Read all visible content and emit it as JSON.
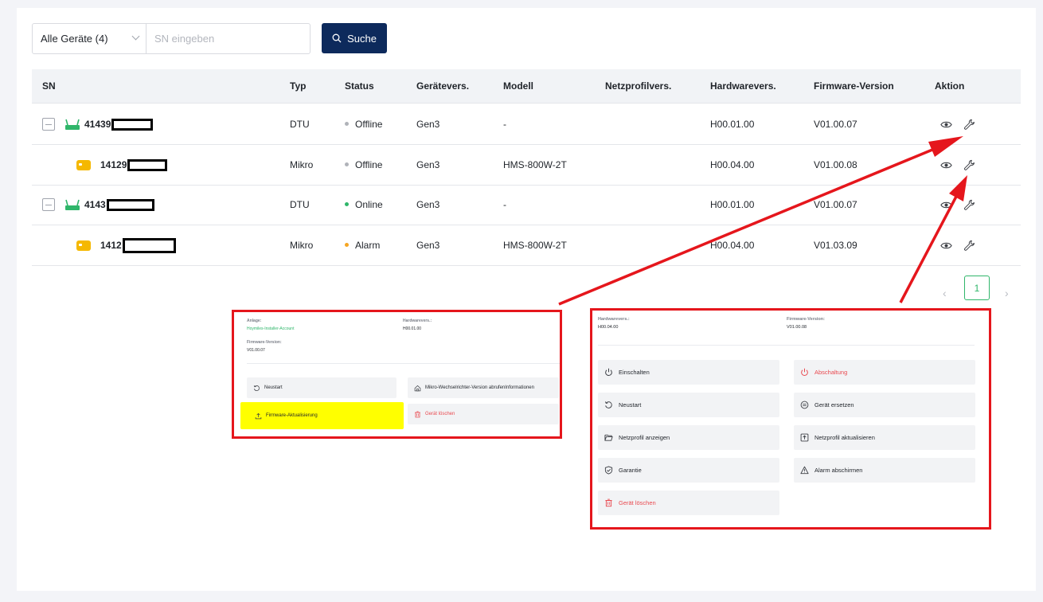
{
  "search": {
    "filter_value": "Alle Geräte (4)",
    "placeholder": "SN eingeben",
    "button_label": "Suche"
  },
  "table": {
    "headers": [
      "SN",
      "Typ",
      "Status",
      "Gerätevers.",
      "Modell",
      "Netzprofilvers.",
      "Hardwarevers.",
      "Firmware-Version",
      "Aktion"
    ],
    "rows": [
      {
        "sn": "41439",
        "typ": "DTU",
        "status": "Offline",
        "status_color": "#b0b3b9",
        "geraetevers": "Gen3",
        "modell": "-",
        "netzprofil": "",
        "hardware": "H00.01.00",
        "firmware": "V01.00.07"
      },
      {
        "sn": "14129",
        "typ": "Mikro",
        "status": "Offline",
        "status_color": "#b0b3b9",
        "geraetevers": "Gen3",
        "modell": "HMS-800W-2T",
        "netzprofil": "",
        "hardware": "H00.04.00",
        "firmware": "V01.00.08"
      },
      {
        "sn": "4143",
        "typ": "DTU",
        "status": "Online",
        "status_color": "#2fb66a",
        "geraetevers": "Gen3",
        "modell": "-",
        "netzprofil": "",
        "hardware": "H00.01.00",
        "firmware": "V01.00.07"
      },
      {
        "sn": "1412",
        "typ": "Mikro",
        "status": "Alarm",
        "status_color": "#f5a623",
        "geraetevers": "Gen3",
        "modell": "HMS-800W-2T",
        "netzprofil": "",
        "hardware": "H00.04.00",
        "firmware": "V01.03.09"
      }
    ]
  },
  "pagination": {
    "prev": "‹",
    "page": "1",
    "next": "›"
  },
  "dtu_panel": {
    "anlage_label": "Anlage:",
    "anlage_value": "Hoymiles-Installer-Account",
    "hardware_label": "Hardwarevers.:",
    "hardware_value": "H00.01.00",
    "firmware_label": "Firmware-Version:",
    "firmware_value": "V01.00.07",
    "btn_neustart": "Neustart",
    "btn_mikro_version": "Mikro-Wechselrichter-Version abrufenInformationen",
    "btn_firmware": "Firmware-Aktualisierung",
    "btn_delete": "Gerät löschen"
  },
  "micro_panel": {
    "hardware_label": "Hardwarevers.:",
    "hardware_value": "H00.04.00",
    "firmware_label": "Firmware-Version:",
    "firmware_value": "V01.00.08",
    "btn_einschalten": "Einschalten",
    "btn_abschaltung": "Abschaltung",
    "btn_neustart": "Neustart",
    "btn_ersetzen": "Gerät ersetzen",
    "btn_netzprofil_anzeigen": "Netzprofil anzeigen",
    "btn_netzprofil_aktualisieren": "Netzprofil aktualisieren",
    "btn_garantie": "Garantie",
    "btn_alarm": "Alarm abschirmen",
    "btn_delete": "Gerät löschen"
  },
  "colors": {
    "primary": "#0d2a5c",
    "accent": "#2fb66a",
    "danger": "#e9494f",
    "callout": "#e5161c",
    "highlight": "#ffff00"
  }
}
